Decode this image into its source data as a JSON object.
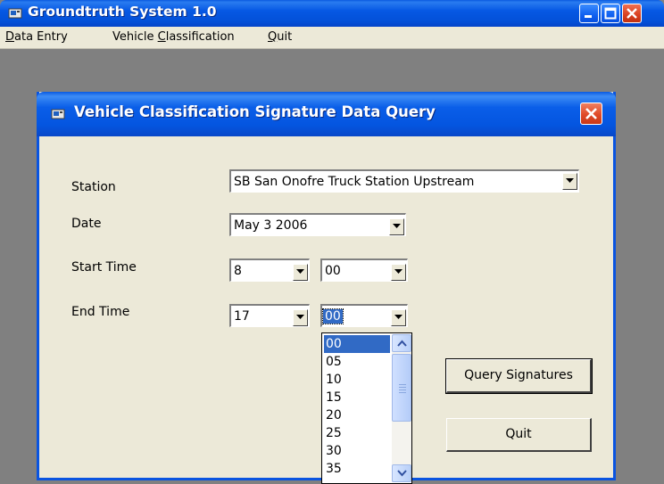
{
  "main_window": {
    "title": "Groundtruth System 1.0",
    "menu": [
      {
        "label_pre": "",
        "label_ul": "D",
        "label_post": "ata Entry"
      },
      {
        "label_pre": "Vehicle ",
        "label_ul": "C",
        "label_post": "lassification"
      },
      {
        "label_pre": "",
        "label_ul": "Q",
        "label_post": "uit"
      }
    ]
  },
  "dialog": {
    "title": "Vehicle Classification Signature Data Query",
    "labels": {
      "station": "Station",
      "date": "Date",
      "start_time": "Start Time",
      "end_time": "End Time"
    },
    "station_value": "SB San Onofre Truck Station Upstream",
    "date_value": "May 3 2006",
    "start_hour": "8",
    "start_minute": "00",
    "end_hour": "17",
    "end_minute": "00",
    "buttons": {
      "query": "Query Signatures",
      "quit": "Quit"
    },
    "minute_options": [
      "00",
      "05",
      "10",
      "15",
      "20",
      "25",
      "30",
      "35"
    ],
    "minute_selected": "00"
  },
  "colors": {
    "title_blue": "#0554e0",
    "dialog_bg": "#ece9d8",
    "selection": "#316ac5",
    "close_red": "#e04a28"
  }
}
